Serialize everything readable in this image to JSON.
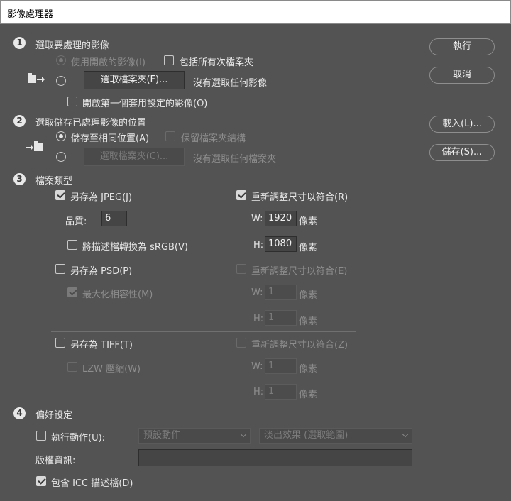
{
  "window": {
    "title": "影像處理器"
  },
  "buttons": {
    "run": "執行",
    "cancel": "取消",
    "load": "載入(L)...",
    "save": "儲存(S)..."
  },
  "section1": {
    "number": "1",
    "title": "選取要處理的影像",
    "use_open_images": "使用開啟的影像(I)",
    "include_subfolders": "包括所有次檔案夾",
    "select_folder_button": "選取檔案夾(F)...",
    "no_image_selected": "沒有選取任何影像",
    "open_first_image": "開啟第一個套用設定的影像(O)"
  },
  "section2": {
    "number": "2",
    "title": "選取儲存已處理影像的位置",
    "save_same_location": "儲存至相同位置(A)",
    "keep_folder_structure": "保留檔案夾結構",
    "select_folder_button": "選取檔案夾(C)...",
    "no_folder_selected": "沒有選取任何檔案夾"
  },
  "section3": {
    "number": "3",
    "title": "檔案類型",
    "jpeg": {
      "save_as": "另存為 JPEG(J)",
      "resize": "重新調整尺寸以符合(R)",
      "quality_label": "品質:",
      "quality_value": "6",
      "w_label": "W:",
      "w_value": "1920",
      "w_unit": "像素",
      "h_label": "H:",
      "h_value": "1080",
      "h_unit": "像素",
      "convert_srgb": "將描述檔轉換為 sRGB(V)"
    },
    "psd": {
      "save_as": "另存為 PSD(P)",
      "resize": "重新調整尺寸以符合(E)",
      "maximize_compat": "最大化相容性(M)",
      "w_label": "W:",
      "w_value": "1",
      "w_unit": "像素",
      "h_label": "H:",
      "h_value": "1",
      "h_unit": "像素"
    },
    "tiff": {
      "save_as": "另存為 TIFF(T)",
      "resize": "重新調整尺寸以符合(Z)",
      "lzw": "LZW 壓縮(W)",
      "w_label": "W:",
      "w_value": "1",
      "w_unit": "像素",
      "h_label": "H:",
      "h_value": "1",
      "h_unit": "像素"
    }
  },
  "section4": {
    "number": "4",
    "title": "偏好設定",
    "run_action": "執行動作(U):",
    "action_set": "預設動作",
    "action": "淡出效果 (選取範圍)",
    "copyright_label": "版權資訊:",
    "copyright_value": "",
    "include_icc": "包含 ICC 描述檔(D)"
  }
}
